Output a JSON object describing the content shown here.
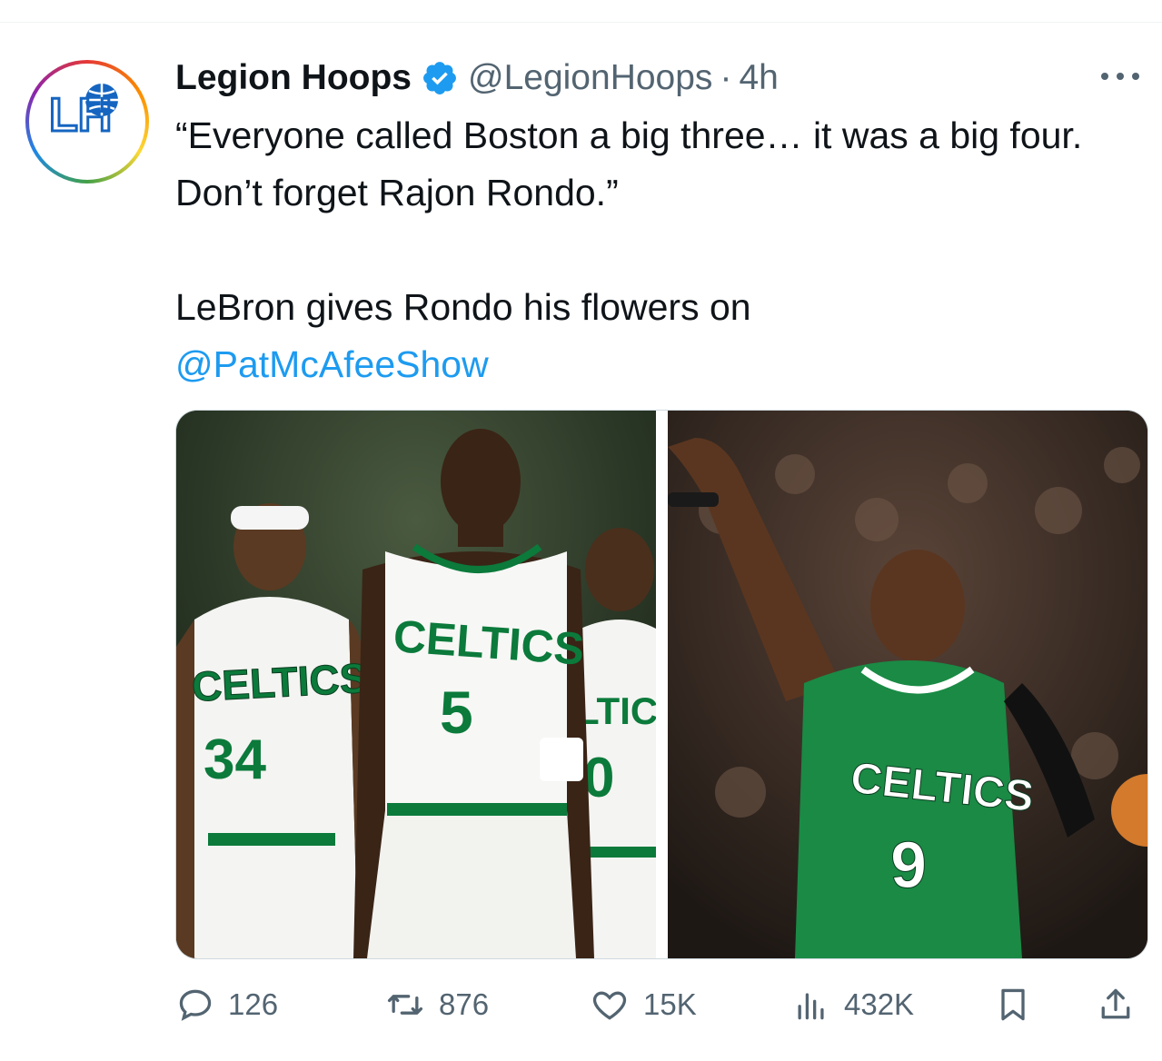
{
  "tweet": {
    "author_name": "Legion Hoops",
    "handle": "@LegionHoops",
    "separator": "·",
    "time": "4h",
    "avatar_text": "LH",
    "text_line1": "“Everyone called Boston a big three… it was a big four. Don’t forget Rajon Rondo.”",
    "text_line2": "LeBron gives Rondo his flowers on",
    "mention": "@PatMcAfeeShow"
  },
  "media": {
    "left_photo": {
      "jersey_word": "CELTICS",
      "players": [
        {
          "number": "34"
        },
        {
          "number": "5"
        },
        {
          "number": "0",
          "word_partial": "LTICS"
        }
      ]
    },
    "right_photo": {
      "jersey_word": "CELTICS",
      "number": "9"
    }
  },
  "stats": {
    "replies": "126",
    "retweets": "876",
    "likes": "15K",
    "views": "432K"
  },
  "icons": {
    "reply": "reply-icon",
    "retweet": "retweet-icon",
    "like": "heart-icon",
    "views": "views-icon",
    "bookmark": "bookmark-icon",
    "share": "share-icon",
    "verified": "verified-badge-icon",
    "more": "more-icon"
  },
  "colors": {
    "link": "#1d9bf0",
    "muted": "#536471",
    "celtics_green": "#0b7a3b",
    "verified_blue": "#1d9bf0"
  }
}
